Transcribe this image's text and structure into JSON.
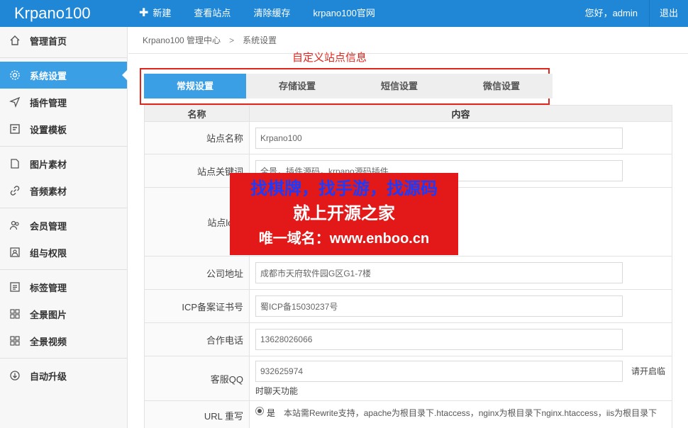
{
  "app": {
    "brand": "Krpano100",
    "nav": [
      {
        "label": "新建"
      },
      {
        "label": "查看站点"
      },
      {
        "label": "清除缓存"
      },
      {
        "label": "krpano100官网"
      }
    ],
    "greeting": "您好，admin",
    "logout": "退出"
  },
  "sidebar": {
    "items": [
      {
        "label": "管理首页",
        "icon": "home-icon"
      },
      {
        "label": "系统设置",
        "icon": "gear-icon",
        "active": true
      },
      {
        "label": "插件管理",
        "icon": "send-icon"
      },
      {
        "label": "设置模板",
        "icon": "template-icon"
      },
      {
        "label": "图片素材",
        "icon": "document-icon"
      },
      {
        "label": "音频素材",
        "icon": "link-icon"
      },
      {
        "label": "会员管理",
        "icon": "users-icon"
      },
      {
        "label": "组与权限",
        "icon": "image-icon"
      },
      {
        "label": "标签管理",
        "icon": "list-icon"
      },
      {
        "label": "全景图片",
        "icon": "grid-icon"
      },
      {
        "label": "全景视频",
        "icon": "grid-icon"
      },
      {
        "label": "自动升级",
        "icon": "download-icon"
      }
    ]
  },
  "breadcrumb": {
    "root": "Krpano100 管理中心",
    "sep": ">",
    "current": "系统设置"
  },
  "annotation": "自定义站点信息",
  "tabs": [
    {
      "label": "常规设置",
      "active": true
    },
    {
      "label": "存储设置"
    },
    {
      "label": "短信设置"
    },
    {
      "label": "微信设置"
    }
  ],
  "table": {
    "header_name": "名称",
    "header_content": "内容"
  },
  "fields": {
    "site_name": {
      "label": "站点名称",
      "value": "Krpano100"
    },
    "site_keywords": {
      "label": "站点关键词",
      "value": "全景，插件源码，krpano源码插件"
    },
    "site_logo": {
      "label": "站点logo"
    },
    "address": {
      "label": "公司地址",
      "value": "成都市天府软件园G区G1-7楼"
    },
    "icp": {
      "label": "ICP备案证书号",
      "value": "蜀ICP备15030237号"
    },
    "phone": {
      "label": "合作电话",
      "value": "13628026066"
    },
    "qq": {
      "label": "客服QQ",
      "value": "932625974",
      "suffix": "请开启临",
      "note": "时聊天功能"
    },
    "url_rewrite": {
      "label": "URL 重写",
      "option": "是",
      "note": "本站需Rewrite支持，apache为根目录下.htaccess，nginx为根目录下nginx.htaccess，iis为根目录下"
    }
  },
  "watermark": {
    "line1": "找棋牌，找手游，找源码",
    "line2": "就上开源之家",
    "line3": "唯一域名：www.enboo.cn"
  },
  "colors": {
    "primary": "#1f87d6",
    "active": "#3b9fe6",
    "annotation": "#e0251d"
  }
}
